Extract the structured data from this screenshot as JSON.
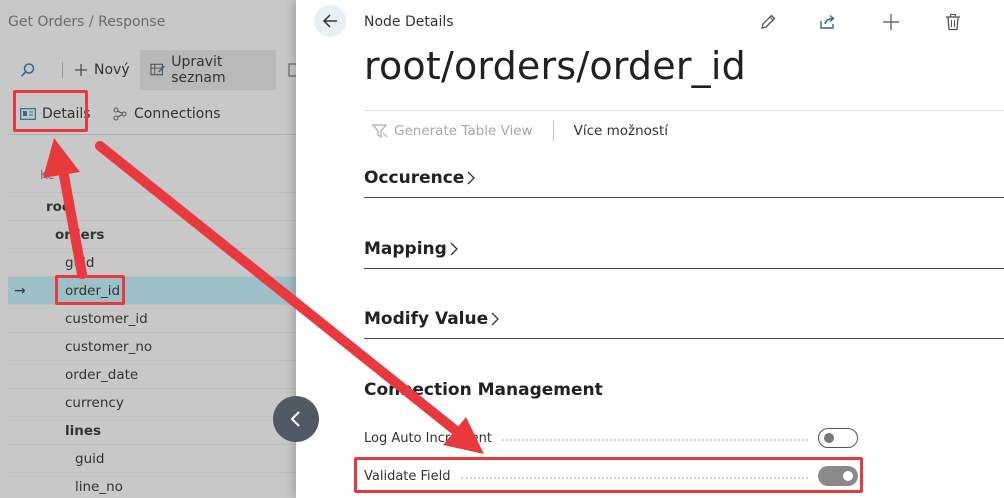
{
  "left_panel": {
    "title": "Get Orders / Response",
    "toolbar": {
      "search_icon": "search-icon",
      "new_label": "Nový",
      "edit_list_label": "Upravit seznam"
    },
    "tabs": {
      "details_label": "Details",
      "connections_label": "Connections"
    },
    "column_header": "Ke",
    "tree": [
      {
        "label": "roo",
        "bold": true,
        "level": 0,
        "selected": false
      },
      {
        "label": "orders",
        "bold": true,
        "level": 1,
        "selected": false
      },
      {
        "label": "guid",
        "bold": false,
        "level": 2,
        "selected": false
      },
      {
        "label": "order_id",
        "bold": false,
        "level": 2,
        "selected": true
      },
      {
        "label": "customer_id",
        "bold": false,
        "level": 2,
        "selected": false
      },
      {
        "label": "customer_no",
        "bold": false,
        "level": 2,
        "selected": false
      },
      {
        "label": "order_date",
        "bold": false,
        "level": 2,
        "selected": false
      },
      {
        "label": "currency",
        "bold": false,
        "level": 2,
        "selected": false
      },
      {
        "label": "lines",
        "bold": true,
        "level": 2,
        "selected": false
      },
      {
        "label": "guid",
        "bold": false,
        "level": 3,
        "selected": false
      },
      {
        "label": "line_no",
        "bold": false,
        "level": 3,
        "selected": false
      }
    ],
    "selected_arrow": "→"
  },
  "right_panel": {
    "header": "Node Details",
    "title": "root/orders/order_id",
    "icons": [
      "pencil-icon",
      "share-icon",
      "plus-icon",
      "trash-icon"
    ],
    "actions": {
      "generate_label": "Generate Table View",
      "more_label": "Více možností"
    },
    "sections": {
      "occurence": "Occurence",
      "mapping": "Mapping",
      "modify_value": "Modify Value",
      "connection_management": "Connection Management"
    },
    "fields": {
      "log_auto_increment": {
        "label": "Log Auto Increment",
        "value": false
      },
      "validate_field": {
        "label": "Validate Field",
        "value": true
      }
    }
  },
  "colors": {
    "accent_highlight": "#e8393f",
    "selected_row": "#9dbfc7",
    "back_button_bg": "#e6f1f6",
    "collapse_button": "#505a64"
  }
}
